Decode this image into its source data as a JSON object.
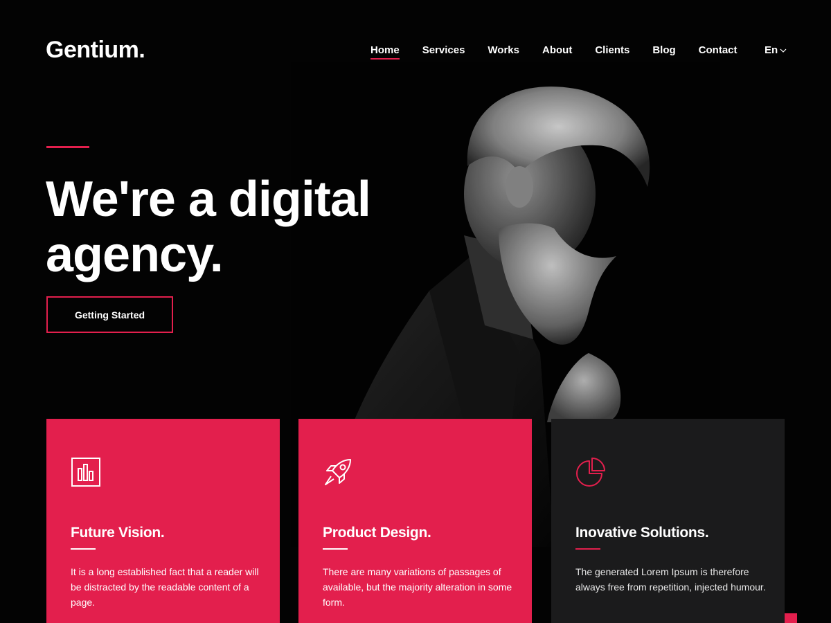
{
  "brand": {
    "logo": "Gentium."
  },
  "nav": {
    "items": [
      {
        "label": "Home",
        "active": true
      },
      {
        "label": "Services",
        "active": false
      },
      {
        "label": "Works",
        "active": false
      },
      {
        "label": "About",
        "active": false
      },
      {
        "label": "Clients",
        "active": false
      },
      {
        "label": "Blog",
        "active": false
      },
      {
        "label": "Contact",
        "active": false
      }
    ],
    "language": "En",
    "language_icon": "chevron-down-icon"
  },
  "hero": {
    "title": "We're a digital agency.",
    "cta_label": "Getting Started",
    "image": "portrait of bearded man"
  },
  "features": [
    {
      "icon": "bar-chart-icon",
      "title": "Future Vision.",
      "text": "It is a long established fact that a reader will be distracted by the readable content of a page.",
      "style": "red"
    },
    {
      "icon": "rocket-icon",
      "title": "Product Design.",
      "text": "There are many variations of passages of available, but the majority alteration in some form.",
      "style": "red"
    },
    {
      "icon": "pie-chart-icon",
      "title": "Inovative Solutions.",
      "text": "The generated Lorem Ipsum is therefore always free from repetition, injected humour.",
      "style": "dark"
    }
  ],
  "colors": {
    "accent": "#e31f4d",
    "background": "#030303",
    "dark_card": "#1b1b1c",
    "text": "#ffffff"
  }
}
